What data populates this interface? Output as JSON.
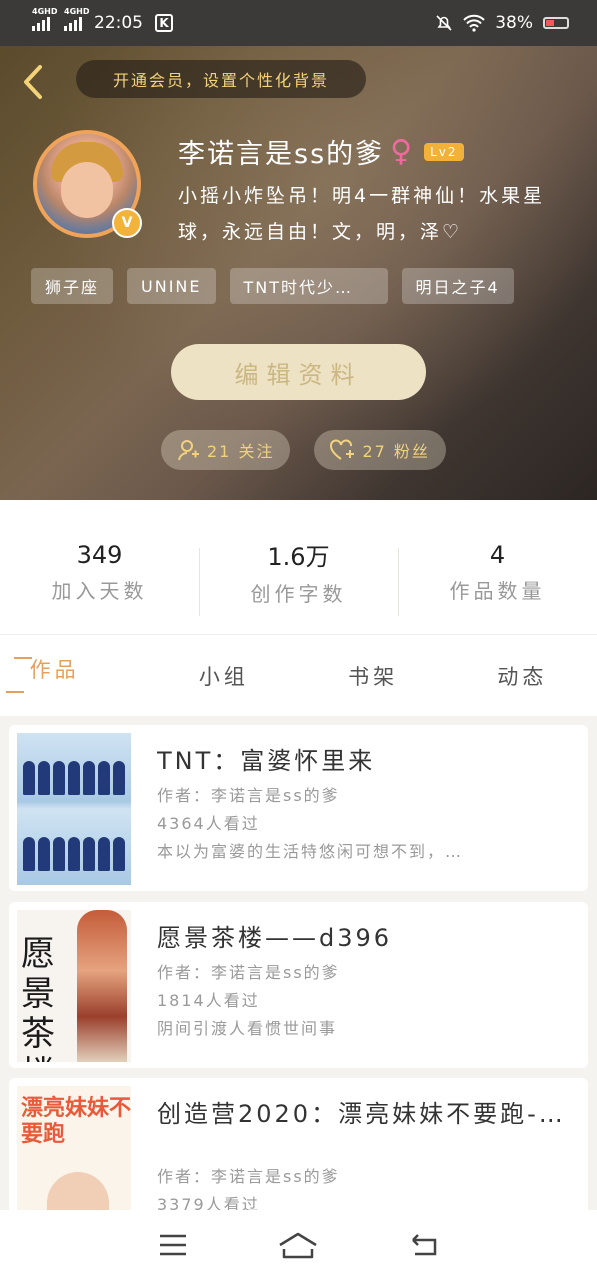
{
  "status_bar": {
    "net1": "4GHD",
    "net2": "4GHD",
    "time": "22:05",
    "app_badge": "K",
    "battery": "38%"
  },
  "header": {
    "vip_prompt": "开通会员，设置个性化背景",
    "username": "李诺言是ss的爹",
    "gender_symbol": "♀",
    "level": "Lv2",
    "verified_badge": "V",
    "bio": "小摇小炸坠吊！明4一群神仙！水果星球，永远自由！文，明，泽♡",
    "tags": [
      "狮子座",
      "UNINE",
      "TNT时代少…",
      "明日之子4"
    ],
    "edit_label": "编辑资料",
    "following": "21 关注",
    "followers": "27 粉丝"
  },
  "stats": [
    {
      "value": "349",
      "label": "加入天数"
    },
    {
      "value": "1.6万",
      "label": "创作字数"
    },
    {
      "value": "4",
      "label": "作品数量"
    }
  ],
  "tabs": [
    "作品",
    "小组",
    "书架",
    "动态"
  ],
  "works": [
    {
      "title": "TNT：富婆怀里来",
      "author": "作者：李诺言是ss的爹",
      "views": "4364人看过",
      "summary": "本以为富婆的生活特悠闲可想不到，…"
    },
    {
      "title": "愿景茶楼——d396",
      "author": "作者：李诺言是ss的爹",
      "views": "1814人看过",
      "summary": "阴间引渡人看惯世间事",
      "cover_text": "愿景茶楼"
    },
    {
      "title": "创造营2020：漂亮妹妹不要跑-d…",
      "author": "作者：李诺言是ss的爹",
      "views": "3379人看过",
      "cover_text": "漂亮妹妹不要跑"
    }
  ],
  "colors": {
    "accent": "#e6a05e",
    "vip_text": "#f3d37a",
    "edit_button": "#ede2c3"
  }
}
